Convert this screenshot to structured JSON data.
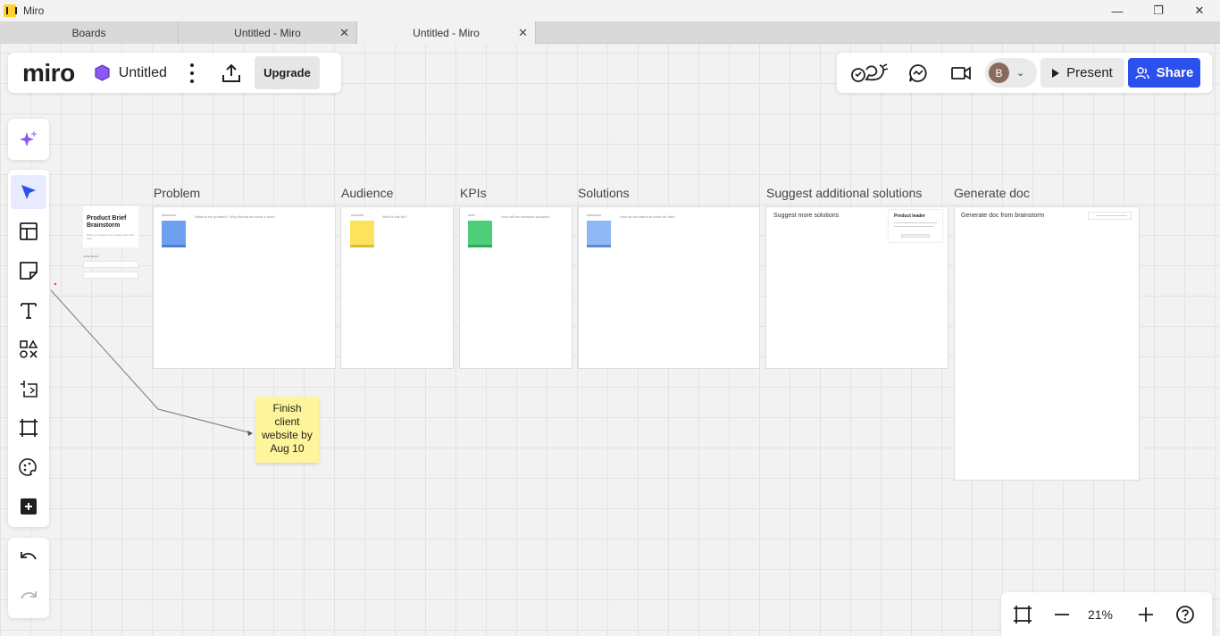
{
  "window": {
    "app_title": "Miro",
    "minimize": "—",
    "maximize": "❐",
    "close": "✕"
  },
  "tabs": [
    {
      "label": "Boards"
    },
    {
      "label": "Untitled - Miro"
    },
    {
      "label": "Untitled - Miro"
    }
  ],
  "board": {
    "logo": "miro",
    "name": "Untitled",
    "upgrade_label": "Upgrade"
  },
  "collab": {
    "avatar_initial": "B",
    "present_label": "Present",
    "share_label": "Share"
  },
  "zoom": {
    "level": "21%"
  },
  "frames": [
    {
      "label": "Problem",
      "caption": "What is the problem? Why should we solve it now?"
    },
    {
      "label": "Audience",
      "caption": "Who is this for?"
    },
    {
      "label": "KPIs",
      "caption": "How will we measure success?"
    },
    {
      "label": "Solutions",
      "caption": "How do we intend to solve for this?"
    },
    {
      "label": "Suggest additional solutions",
      "caption": "Suggest more solutions"
    },
    {
      "label": "Generate doc",
      "caption": "Generate doc from brainstorm"
    }
  ],
  "brief": {
    "title": "Product Brief Brainstorm",
    "subtitle": "Write your ideas on the sticky notes then click",
    "section_label": "In this board"
  },
  "suggest_card": {
    "title": "Product leader"
  },
  "sticky": {
    "text": "Finish client website by Aug 10"
  },
  "colors": {
    "accent": "#2b50ec",
    "sticky_yellow": "#fef49c",
    "note_blue": "#6ea0f0",
    "note_yellow": "#fbe35d",
    "note_green": "#4fce7a",
    "note_lightblue": "#8fb8f5",
    "ai_purple": "#8c58f0"
  }
}
